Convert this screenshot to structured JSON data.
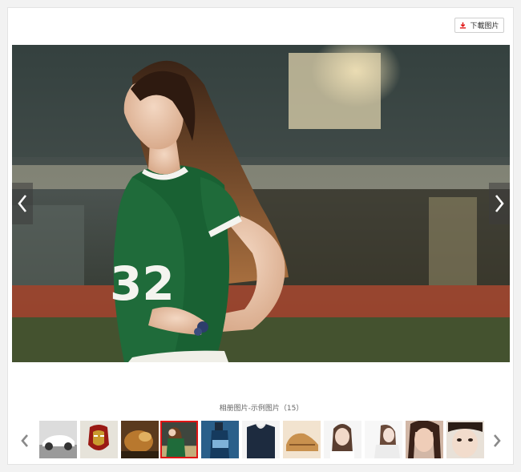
{
  "toolbar": {
    "download_label": "下載图片",
    "download_icon": "download-icon",
    "accent_color": "#e01515"
  },
  "viewer": {
    "caption": "相册图片-示例图片（15）",
    "jersey_number": "32",
    "prev_icon": "chevron-left-icon",
    "next_icon": "chevron-right-icon"
  },
  "thumbnails": {
    "count_visible": 11,
    "selected_index": 3,
    "items": [
      {
        "subject": "white-car"
      },
      {
        "subject": "iron-man"
      },
      {
        "subject": "animal"
      },
      {
        "subject": "woman-green-shirt"
      },
      {
        "subject": "bottle"
      },
      {
        "subject": "dark-clothing"
      },
      {
        "subject": "shoes"
      },
      {
        "subject": "woman-portrait"
      },
      {
        "subject": "woman-white"
      },
      {
        "subject": "woman-face"
      },
      {
        "subject": "woman-closeup"
      }
    ]
  }
}
